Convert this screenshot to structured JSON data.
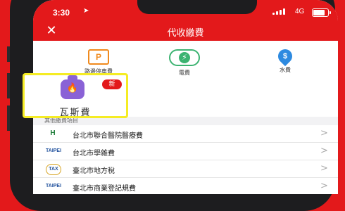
{
  "status": {
    "time": "3:30",
    "network": "4G"
  },
  "nav": {
    "title": "代收繳費",
    "close_symbol": "✕"
  },
  "services": [
    {
      "label": "路邊停車費",
      "icon": "parking-icon",
      "icon_text": "P"
    },
    {
      "label": "電費",
      "icon": "lightning-icon",
      "icon_text": "⚡"
    },
    {
      "label": "水費",
      "icon": "water-drop-icon",
      "icon_text": "$"
    }
  ],
  "featured": {
    "label": "瓦斯費",
    "badge": "新",
    "icon": "gas-cylinder-icon",
    "highlight_color": "#f5ec24"
  },
  "section": {
    "title": "其他繳費項目"
  },
  "list": [
    {
      "name": "台北市聯合醫院醫療費",
      "logo": "H",
      "icon": "hospital-logo-icon"
    },
    {
      "name": "台北市學雜費",
      "logo": "TAIPEI",
      "icon": "taipei-city-logo-icon"
    },
    {
      "name": "臺北市地方稅",
      "logo": "TAX",
      "icon": "tax-logo-icon"
    },
    {
      "name": "臺北市商業登記規費",
      "logo": "TAIPEI",
      "icon": "taipei-city-logo-icon"
    }
  ],
  "colors": {
    "brand_red": "#e3191b",
    "parking": "#f08a1d",
    "electric": "#3cb371",
    "water": "#2d8ae0",
    "gas": "#8a62d6"
  }
}
